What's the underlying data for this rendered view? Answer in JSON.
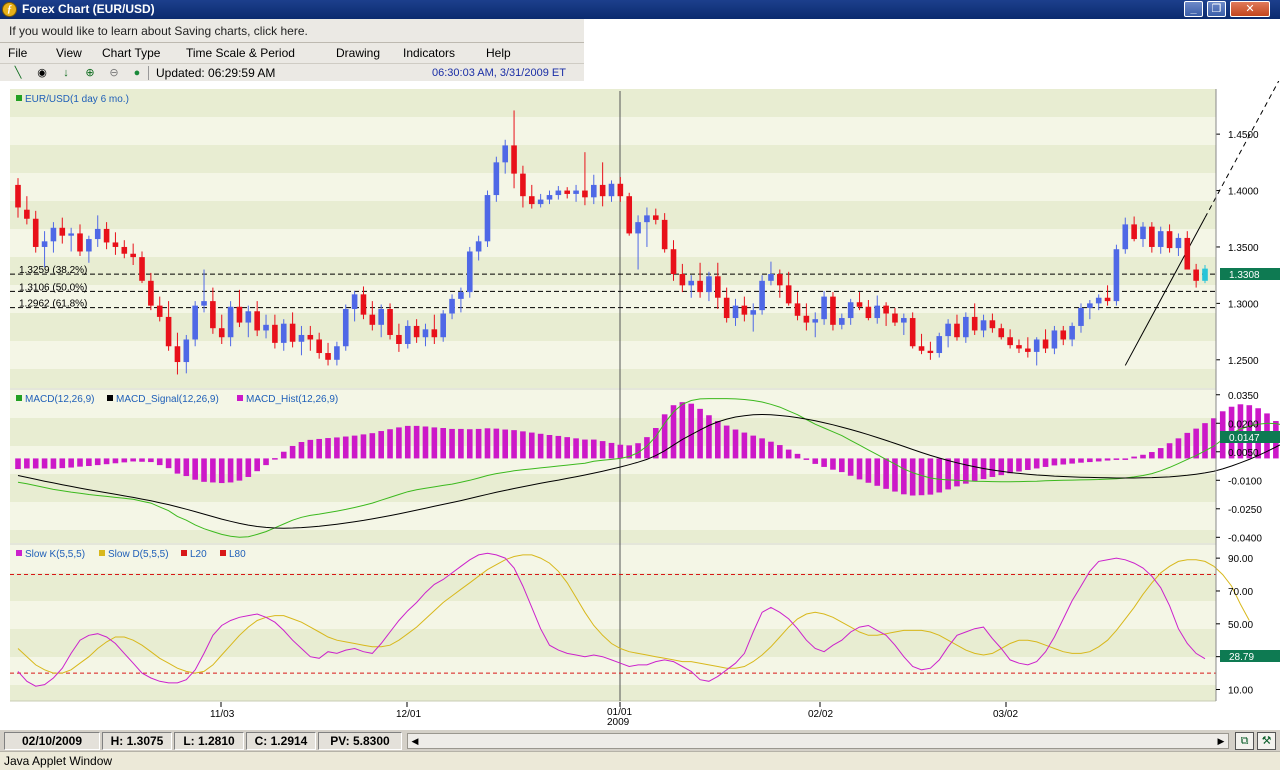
{
  "window": {
    "title": "Forex Chart (EUR/USD)",
    "app_icon": "forex-chart-logo-icon",
    "buttons": [
      "minimize-icon",
      "restore-icon",
      "close-icon"
    ]
  },
  "info_bar": {
    "text": "If you would like to learn about Saving charts, click here."
  },
  "menu": [
    "File",
    "View",
    "Chart Type",
    "Time Scale & Period",
    "Drawing",
    "Indicators",
    "Help"
  ],
  "toolbar": {
    "icons": [
      "draw-line-icon",
      "crosshair-icon",
      "down-arrow-icon",
      "zoom-in-icon",
      "zoom-out-icon",
      "status-dot-icon"
    ],
    "updated": "Updated: 06:29:59 AM",
    "datetime": "06:30:03 AM, 3/31/2009 ET"
  },
  "colors": {
    "bull": "#4f68e6",
    "bear": "#e8101a",
    "last_candle": "#28c4d8",
    "macd": "#3cb91e",
    "signal": "#000000",
    "hist": "#cc18c8",
    "slow_k": "#cc22cc",
    "slow_d": "#d8b81c",
    "levels": "#d81818",
    "value_box": "#0e7a52",
    "band_light": "#f4f6e6",
    "band_dark": "#e8edd2"
  },
  "panels": {
    "price": {
      "legend": "EUR/USD(1 day  6 mo.)",
      "ticks": [
        "1.4500",
        "1.4000",
        "1.3500",
        "1.3000",
        "1.2500"
      ],
      "last_value": "1.3308",
      "fib_labels": [
        "1.3259 (38.2%)",
        "1.3106 (50.0%)",
        "1.2962 (61.8%)"
      ]
    },
    "macd": {
      "legend": [
        "MACD(12,26,9)",
        "MACD_Signal(12,26,9)",
        "MACD_Hist(12,26,9)"
      ],
      "ticks": [
        "0.0350",
        "0.0200",
        "0.0050",
        "-0.0100",
        "-0.0250",
        "-0.0400"
      ],
      "last_value": "0.0147"
    },
    "stoch": {
      "legend": [
        "Slow K(5,5,5)",
        "Slow D(5,5,5)",
        "L20",
        "L80"
      ],
      "ticks": [
        "90.00",
        "70.00",
        "50.00",
        "30.00",
        "10.00"
      ],
      "last_value": "28.79"
    },
    "x_labels": [
      "11/03",
      "12/01",
      "01/01",
      "2009",
      "02/02",
      "03/02"
    ]
  },
  "status": {
    "date": "02/10/2009",
    "high": "H: 1.3075",
    "low": "L: 1.2810",
    "close": "C: 1.2914",
    "pv": "PV: 5.8300"
  },
  "applet": {
    "label": "Java Applet Window"
  },
  "chart_data": {
    "type": "candlestick",
    "title": "EUR/USD(1 day  6 mo.)",
    "price_ylim": [
      1.225,
      1.49
    ],
    "fib_levels": [
      1.3259,
      1.3106,
      1.2962
    ],
    "last_price": 1.3308,
    "ohlc": [
      [
        1.405,
        1.411,
        1.376,
        1.385
      ],
      [
        1.383,
        1.395,
        1.37,
        1.375
      ],
      [
        1.375,
        1.382,
        1.345,
        1.35
      ],
      [
        1.35,
        1.364,
        1.332,
        1.355
      ],
      [
        1.355,
        1.372,
        1.345,
        1.367
      ],
      [
        1.367,
        1.376,
        1.353,
        1.36
      ],
      [
        1.36,
        1.367,
        1.346,
        1.362
      ],
      [
        1.362,
        1.37,
        1.342,
        1.346
      ],
      [
        1.346,
        1.36,
        1.336,
        1.357
      ],
      [
        1.357,
        1.378,
        1.35,
        1.366
      ],
      [
        1.366,
        1.372,
        1.348,
        1.354
      ],
      [
        1.354,
        1.363,
        1.343,
        1.35
      ],
      [
        1.35,
        1.356,
        1.34,
        1.344
      ],
      [
        1.344,
        1.353,
        1.334,
        1.341
      ],
      [
        1.341,
        1.346,
        1.318,
        1.32
      ],
      [
        1.32,
        1.327,
        1.294,
        1.298
      ],
      [
        1.298,
        1.306,
        1.284,
        1.288
      ],
      [
        1.288,
        1.302,
        1.258,
        1.262
      ],
      [
        1.262,
        1.274,
        1.237,
        1.248
      ],
      [
        1.248,
        1.272,
        1.238,
        1.268
      ],
      [
        1.268,
        1.302,
        1.262,
        1.298
      ],
      [
        1.298,
        1.33,
        1.292,
        1.302
      ],
      [
        1.302,
        1.314,
        1.273,
        1.278
      ],
      [
        1.278,
        1.29,
        1.264,
        1.27
      ],
      [
        1.27,
        1.302,
        1.262,
        1.297
      ],
      [
        1.297,
        1.312,
        1.279,
        1.283
      ],
      [
        1.283,
        1.298,
        1.27,
        1.293
      ],
      [
        1.293,
        1.302,
        1.271,
        1.276
      ],
      [
        1.276,
        1.29,
        1.269,
        1.281
      ],
      [
        1.281,
        1.29,
        1.26,
        1.265
      ],
      [
        1.265,
        1.286,
        1.258,
        1.282
      ],
      [
        1.282,
        1.292,
        1.261,
        1.266
      ],
      [
        1.266,
        1.28,
        1.254,
        1.272
      ],
      [
        1.272,
        1.28,
        1.258,
        1.268
      ],
      [
        1.268,
        1.274,
        1.251,
        1.256
      ],
      [
        1.256,
        1.265,
        1.245,
        1.25
      ],
      [
        1.25,
        1.266,
        1.245,
        1.262
      ],
      [
        1.262,
        1.299,
        1.258,
        1.295
      ],
      [
        1.295,
        1.311,
        1.284,
        1.308
      ],
      [
        1.308,
        1.315,
        1.286,
        1.29
      ],
      [
        1.29,
        1.302,
        1.276,
        1.281
      ],
      [
        1.281,
        1.299,
        1.27,
        1.295
      ],
      [
        1.295,
        1.3,
        1.268,
        1.272
      ],
      [
        1.272,
        1.282,
        1.257,
        1.264
      ],
      [
        1.264,
        1.285,
        1.26,
        1.28
      ],
      [
        1.28,
        1.286,
        1.265,
        1.27
      ],
      [
        1.27,
        1.282,
        1.262,
        1.277
      ],
      [
        1.277,
        1.29,
        1.264,
        1.27
      ],
      [
        1.27,
        1.294,
        1.266,
        1.291
      ],
      [
        1.291,
        1.308,
        1.286,
        1.304
      ],
      [
        1.304,
        1.314,
        1.292,
        1.31
      ],
      [
        1.31,
        1.35,
        1.305,
        1.346
      ],
      [
        1.346,
        1.36,
        1.338,
        1.355
      ],
      [
        1.355,
        1.4,
        1.35,
        1.396
      ],
      [
        1.396,
        1.43,
        1.39,
        1.425
      ],
      [
        1.425,
        1.445,
        1.415,
        1.44
      ],
      [
        1.44,
        1.471,
        1.402,
        1.415
      ],
      [
        1.415,
        1.422,
        1.385,
        1.395
      ],
      [
        1.395,
        1.405,
        1.384,
        1.388
      ],
      [
        1.388,
        1.397,
        1.385,
        1.392
      ],
      [
        1.392,
        1.4,
        1.388,
        1.396
      ],
      [
        1.396,
        1.404,
        1.392,
        1.4
      ],
      [
        1.4,
        1.403,
        1.393,
        1.397
      ],
      [
        1.397,
        1.405,
        1.39,
        1.4
      ],
      [
        1.4,
        1.434,
        1.387,
        1.394
      ],
      [
        1.394,
        1.414,
        1.388,
        1.405
      ],
      [
        1.405,
        1.425,
        1.386,
        1.395
      ],
      [
        1.395,
        1.409,
        1.39,
        1.406
      ],
      [
        1.406,
        1.412,
        1.39,
        1.395
      ],
      [
        1.395,
        1.398,
        1.36,
        1.362
      ],
      [
        1.362,
        1.378,
        1.33,
        1.372
      ],
      [
        1.372,
        1.385,
        1.35,
        1.378
      ],
      [
        1.378,
        1.384,
        1.37,
        1.374
      ],
      [
        1.374,
        1.38,
        1.345,
        1.348
      ],
      [
        1.348,
        1.356,
        1.32,
        1.326
      ],
      [
        1.326,
        1.335,
        1.31,
        1.316
      ],
      [
        1.316,
        1.325,
        1.305,
        1.32
      ],
      [
        1.32,
        1.336,
        1.305,
        1.31
      ],
      [
        1.31,
        1.328,
        1.302,
        1.324
      ],
      [
        1.324,
        1.336,
        1.295,
        1.305
      ],
      [
        1.305,
        1.314,
        1.283,
        1.287
      ],
      [
        1.287,
        1.304,
        1.28,
        1.298
      ],
      [
        1.298,
        1.306,
        1.284,
        1.29
      ],
      [
        1.29,
        1.3,
        1.275,
        1.294
      ],
      [
        1.294,
        1.325,
        1.29,
        1.32
      ],
      [
        1.32,
        1.337,
        1.316,
        1.326
      ],
      [
        1.326,
        1.33,
        1.305,
        1.316
      ],
      [
        1.316,
        1.328,
        1.298,
        1.3
      ],
      [
        1.3,
        1.31,
        1.285,
        1.289
      ],
      [
        1.289,
        1.3,
        1.276,
        1.283
      ],
      [
        1.283,
        1.292,
        1.27,
        1.286
      ],
      [
        1.286,
        1.311,
        1.281,
        1.306
      ],
      [
        1.306,
        1.31,
        1.276,
        1.281
      ],
      [
        1.281,
        1.291,
        1.277,
        1.287
      ],
      [
        1.287,
        1.304,
        1.281,
        1.301
      ],
      [
        1.301,
        1.31,
        1.294,
        1.297
      ],
      [
        1.297,
        1.303,
        1.285,
        1.287
      ],
      [
        1.287,
        1.307,
        1.282,
        1.298
      ],
      [
        1.298,
        1.301,
        1.28,
        1.291
      ],
      [
        1.291,
        1.296,
        1.28,
        1.283
      ],
      [
        1.283,
        1.291,
        1.272,
        1.287
      ],
      [
        1.287,
        1.292,
        1.26,
        1.262
      ],
      [
        1.262,
        1.273,
        1.255,
        1.258
      ],
      [
        1.258,
        1.266,
        1.25,
        1.256
      ],
      [
        1.256,
        1.274,
        1.252,
        1.271
      ],
      [
        1.271,
        1.286,
        1.261,
        1.282
      ],
      [
        1.282,
        1.29,
        1.267,
        1.27
      ],
      [
        1.27,
        1.292,
        1.265,
        1.288
      ],
      [
        1.288,
        1.3,
        1.272,
        1.276
      ],
      [
        1.276,
        1.29,
        1.27,
        1.285
      ],
      [
        1.285,
        1.291,
        1.274,
        1.278
      ],
      [
        1.278,
        1.282,
        1.268,
        1.27
      ],
      [
        1.27,
        1.277,
        1.26,
        1.263
      ],
      [
        1.263,
        1.268,
        1.256,
        1.26
      ],
      [
        1.26,
        1.27,
        1.252,
        1.257
      ],
      [
        1.257,
        1.27,
        1.245,
        1.268
      ],
      [
        1.268,
        1.277,
        1.256,
        1.26
      ],
      [
        1.26,
        1.28,
        1.255,
        1.276
      ],
      [
        1.276,
        1.28,
        1.263,
        1.268
      ],
      [
        1.268,
        1.283,
        1.262,
        1.28
      ],
      [
        1.28,
        1.3,
        1.274,
        1.296
      ],
      [
        1.296,
        1.303,
        1.286,
        1.3
      ],
      [
        1.3,
        1.308,
        1.294,
        1.305
      ],
      [
        1.305,
        1.316,
        1.298,
        1.302
      ],
      [
        1.302,
        1.352,
        1.298,
        1.348
      ],
      [
        1.348,
        1.376,
        1.344,
        1.37
      ],
      [
        1.37,
        1.377,
        1.355,
        1.357
      ],
      [
        1.357,
        1.372,
        1.35,
        1.368
      ],
      [
        1.368,
        1.372,
        1.345,
        1.35
      ],
      [
        1.35,
        1.368,
        1.344,
        1.364
      ],
      [
        1.364,
        1.37,
        1.345,
        1.349
      ],
      [
        1.349,
        1.362,
        1.342,
        1.358
      ],
      [
        1.358,
        1.364,
        1.342,
        1.33
      ],
      [
        1.33,
        1.335,
        1.314,
        1.32
      ],
      [
        1.32,
        1.334,
        1.318,
        1.3308
      ]
    ],
    "macd": [
      -0.011,
      -0.0118,
      -0.0128,
      -0.0138,
      -0.0148,
      -0.0155,
      -0.0162,
      -0.0168,
      -0.0175,
      -0.018,
      -0.0185,
      -0.019,
      -0.0195,
      -0.02,
      -0.021,
      -0.022,
      -0.024,
      -0.026,
      -0.029,
      -0.031,
      -0.0335,
      -0.0355,
      -0.037,
      -0.0385,
      -0.0395,
      -0.04,
      -0.0397,
      -0.0385,
      -0.037,
      -0.035,
      -0.033,
      -0.031,
      -0.0295,
      -0.0285,
      -0.0278,
      -0.027,
      -0.0262,
      -0.0253,
      -0.0243,
      -0.0232,
      -0.022,
      -0.0205,
      -0.019,
      -0.0175,
      -0.016,
      -0.015,
      -0.0142,
      -0.0135,
      -0.0127,
      -0.012,
      -0.011,
      -0.01,
      -0.0088,
      -0.0075,
      -0.0065,
      -0.0058,
      -0.005,
      -0.0045,
      -0.004,
      -0.0035,
      -0.003,
      -0.0025,
      -0.002,
      -0.0015,
      -0.001,
      0.0,
      0.0005,
      0.001,
      0.0015,
      0.0025,
      0.0045,
      0.008,
      0.013,
      0.02,
      0.026,
      0.03,
      0.032,
      0.0328,
      0.033,
      0.033,
      0.033,
      0.0328,
      0.0325,
      0.032,
      0.0312,
      0.03,
      0.0285,
      0.0265,
      0.0245,
      0.022,
      0.0195,
      0.0175,
      0.0155,
      0.0135,
      0.011,
      0.0085,
      0.006,
      0.0035,
      0.001,
      -0.0015,
      -0.004,
      -0.006,
      -0.0075,
      -0.0088,
      -0.0095,
      -0.0098,
      -0.01,
      -0.0102,
      -0.0105,
      -0.0106,
      -0.0107,
      -0.0108,
      -0.0108,
      -0.0107,
      -0.0106,
      -0.0105,
      -0.0103,
      -0.0101,
      -0.01,
      -0.0099,
      -0.0098,
      -0.0097,
      -0.0096,
      -0.0094,
      -0.0092,
      -0.0088,
      -0.0082,
      -0.0075,
      -0.0065,
      -0.005,
      -0.0032,
      -0.0012,
      0.001,
      0.003,
      0.0055,
      0.008,
      0.0115,
      0.0145,
      0.017,
      0.0185,
      0.0195,
      0.02,
      0.0198,
      0.019,
      0.0176,
      0.0162,
      0.0147
    ],
    "macd_signal": [
      -0.0075,
      -0.0085,
      -0.0095,
      -0.0105,
      -0.0114,
      -0.0123,
      -0.0132,
      -0.0141,
      -0.015,
      -0.0158,
      -0.0166,
      -0.0174,
      -0.0182,
      -0.019,
      -0.0199,
      -0.0208,
      -0.0218,
      -0.0228,
      -0.024,
      -0.0252,
      -0.0265,
      -0.0278,
      -0.0291,
      -0.0304,
      -0.0316,
      -0.0327,
      -0.0336,
      -0.0343,
      -0.0348,
      -0.0351,
      -0.0352,
      -0.0351,
      -0.0349,
      -0.0346,
      -0.0342,
      -0.0337,
      -0.0331,
      -0.0325,
      -0.0318,
      -0.0311,
      -0.0303,
      -0.0295,
      -0.0286,
      -0.0277,
      -0.0267,
      -0.0257,
      -0.0247,
      -0.0237,
      -0.0227,
      -0.0217,
      -0.0207,
      -0.0196,
      -0.0185,
      -0.0174,
      -0.0163,
      -0.0153,
      -0.0143,
      -0.0134,
      -0.0125,
      -0.0116,
      -0.0107,
      -0.0099,
      -0.009,
      -0.0081,
      -0.0072,
      -0.0062,
      -0.0052,
      -0.0041,
      -0.003,
      -0.0018,
      -0.0005,
      0.001,
      0.003,
      0.0055,
      0.0085,
      0.0115,
      0.014,
      0.0165,
      0.0188,
      0.0207,
      0.0222,
      0.0233,
      0.024,
      0.0245,
      0.0246,
      0.0245,
      0.0241,
      0.0236,
      0.023,
      0.0222,
      0.0213,
      0.0203,
      0.0192,
      0.018,
      0.0167,
      0.0154,
      0.014,
      0.0125,
      0.011,
      0.0094,
      0.0078,
      0.0062,
      0.0046,
      0.0031,
      0.0017,
      0.0004,
      -0.0008,
      -0.0019,
      -0.0029,
      -0.0038,
      -0.0046,
      -0.0053,
      -0.0059,
      -0.0064,
      -0.0068,
      -0.0072,
      -0.0075,
      -0.0078,
      -0.008,
      -0.0082,
      -0.0084,
      -0.0085,
      -0.0086,
      -0.0087,
      -0.0088,
      -0.0088,
      -0.0088,
      -0.0087,
      -0.0086,
      -0.0084,
      -0.0082,
      -0.0078,
      -0.0074,
      -0.0068,
      -0.0061,
      -0.0052,
      -0.004,
      -0.0025,
      -0.0008,
      0.001,
      0.003,
      0.0052,
      0.0075,
      0.0098,
      0.0118,
      0.0135,
      0.0148,
      0.0157,
      0.0162,
      0.0164
    ],
    "macd_ylim": [
      -0.043,
      0.0375
    ],
    "slow_k": [
      21,
      15,
      12,
      13,
      17,
      23,
      32,
      40,
      43,
      44,
      42,
      38,
      32,
      26,
      20,
      17,
      15,
      14,
      14,
      16,
      22,
      32,
      43,
      49,
      52,
      54,
      55,
      56,
      54,
      51,
      46,
      40,
      35,
      30,
      29,
      33,
      32,
      34,
      35,
      33,
      32,
      38,
      45,
      52,
      58,
      63,
      69,
      74,
      77,
      81,
      85,
      89,
      92,
      93,
      92,
      90,
      84,
      73,
      60,
      47,
      37,
      34,
      32,
      31,
      30,
      31,
      30,
      28,
      26,
      24,
      25,
      25,
      27,
      28,
      27,
      24,
      21,
      16,
      15,
      18,
      22,
      26,
      32,
      45,
      57,
      60,
      57,
      53,
      47,
      40,
      35,
      33,
      37,
      40,
      45,
      48,
      49,
      46,
      43,
      37,
      30,
      24,
      22,
      23,
      28,
      36,
      43,
      45,
      47,
      48,
      41,
      35,
      28,
      26,
      25,
      27,
      33,
      42,
      53,
      64,
      73,
      82,
      88,
      89,
      90,
      89,
      87,
      84,
      79,
      72,
      61,
      47,
      38,
      32,
      28.79
    ],
    "slow_d": [
      35,
      30,
      25,
      22,
      20,
      20,
      22,
      26,
      30,
      35,
      39,
      42,
      42,
      40,
      37,
      33,
      29,
      26,
      23,
      21,
      20,
      21,
      25,
      31,
      37,
      43,
      48,
      52,
      54,
      55,
      55,
      53,
      51,
      48,
      45,
      42,
      40,
      39,
      38,
      37,
      36,
      36,
      37,
      40,
      44,
      48,
      53,
      58,
      63,
      67,
      71,
      75,
      79,
      83,
      86,
      89,
      91,
      92,
      92,
      90,
      87,
      82,
      75,
      66,
      57,
      49,
      43,
      38,
      35,
      33,
      32,
      31,
      30,
      29,
      28,
      27,
      27,
      26,
      25,
      24,
      23,
      23,
      24,
      27,
      31,
      36,
      42,
      48,
      53,
      56,
      57,
      56,
      54,
      51,
      48,
      45,
      43,
      43,
      44,
      45,
      46,
      46,
      46,
      45,
      43,
      40,
      37,
      34,
      32,
      31,
      32,
      35,
      38,
      40,
      40,
      39,
      37,
      35,
      33,
      32,
      32,
      33,
      36,
      40,
      46,
      53,
      60,
      68,
      75,
      81,
      85,
      88,
      89,
      89,
      88,
      85,
      80,
      73,
      62,
      52
    ],
    "stoch_ylim": [
      3,
      98
    ],
    "stoch_levels": [
      20,
      80
    ]
  }
}
